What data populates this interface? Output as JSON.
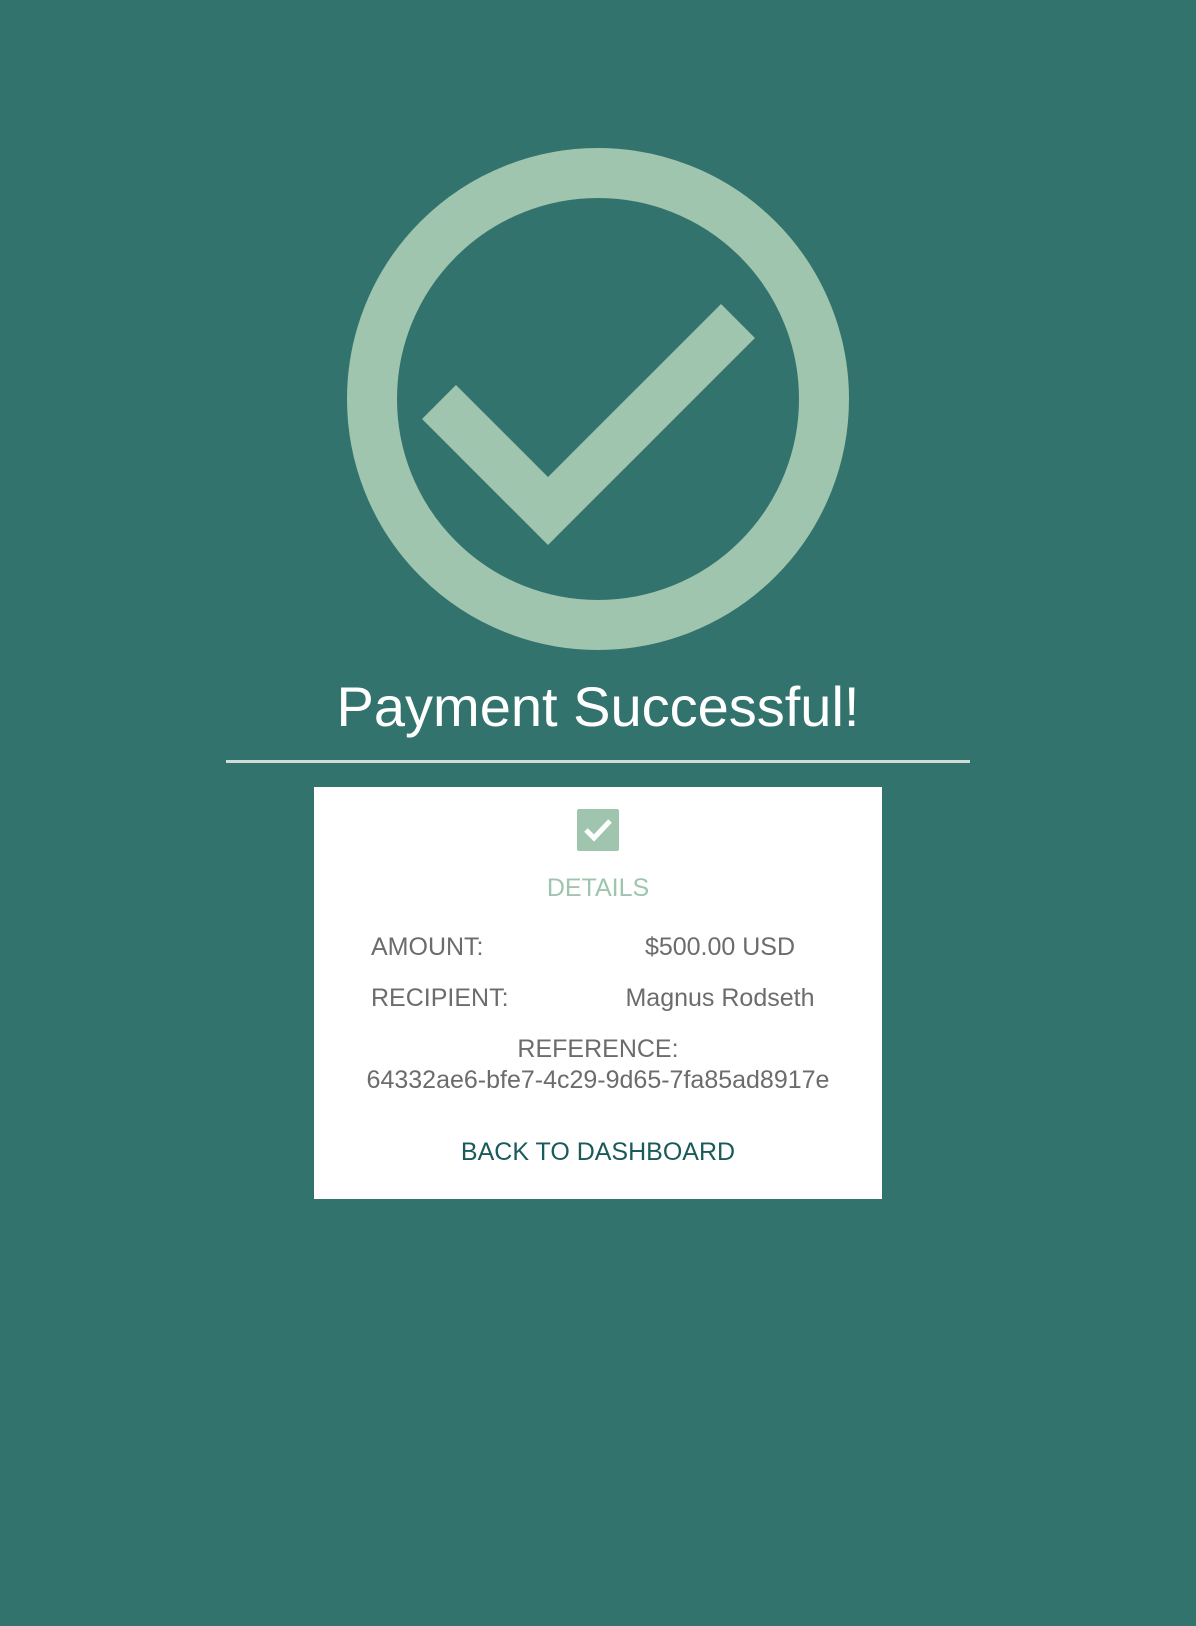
{
  "title": "Payment Successful!",
  "icons": {
    "hero": "circle-check-icon",
    "card": "checkbox-checked-icon"
  },
  "colors": {
    "background": "#33736d",
    "accent": "#9fc5ae",
    "card": "#ffffff",
    "text_muted": "#6c6c6c",
    "link": "#1b5a5a"
  },
  "details": {
    "heading": "DETAILS",
    "amount_label": "AMOUNT:",
    "amount_value": "$500.00 USD",
    "recipient_label": "RECIPIENT:",
    "recipient_value": "Magnus Rodseth",
    "reference_label": "REFERENCE:",
    "reference_value": "64332ae6-bfe7-4c29-9d65-7fa85ad8917e"
  },
  "actions": {
    "back_label": "BACK TO DASHBOARD"
  }
}
